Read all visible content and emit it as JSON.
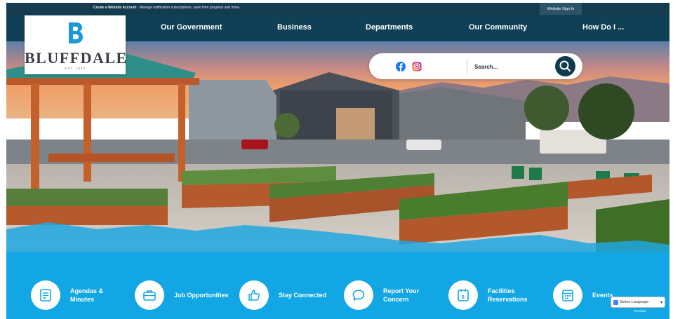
{
  "topbar": {
    "notice_bold": "Create a Website Account",
    "notice_rest": " - Manage notification subscriptions, save form progress and more.",
    "signin_label": "Website Sign In"
  },
  "nav": {
    "items": [
      {
        "label": "Our Government"
      },
      {
        "label": "Business"
      },
      {
        "label": "Departments"
      },
      {
        "label": "Our Community"
      },
      {
        "label": "How Do I ..."
      }
    ]
  },
  "logo": {
    "name": "BLUFFDALE",
    "est": "EST. 1848",
    "icon": "bluffdale-b-logo"
  },
  "search": {
    "placeholder": "Search...",
    "icons": [
      "facebook-icon",
      "instagram-icon",
      "search-icon"
    ]
  },
  "quick_links": [
    {
      "label": "Agendas & Minutes",
      "icon": "agenda-icon"
    },
    {
      "label": "Job Opportunities",
      "icon": "briefcase-icon"
    },
    {
      "label": "Stay Connected",
      "icon": "thumbs-up-icon"
    },
    {
      "label": "Report Your Concern",
      "icon": "chat-icon"
    },
    {
      "label": "Facilities Reservations",
      "icon": "calendar-icon"
    },
    {
      "label": "Events",
      "icon": "events-calendar-icon"
    }
  ],
  "translate": {
    "select_label": "Select Language",
    "powered_by": "Translate"
  },
  "colors": {
    "nav_bg": "#0f4055",
    "topbar_bg": "#153b4f",
    "accent_blue": "#12a6e4",
    "logo_blue": "#1b9ad6"
  }
}
